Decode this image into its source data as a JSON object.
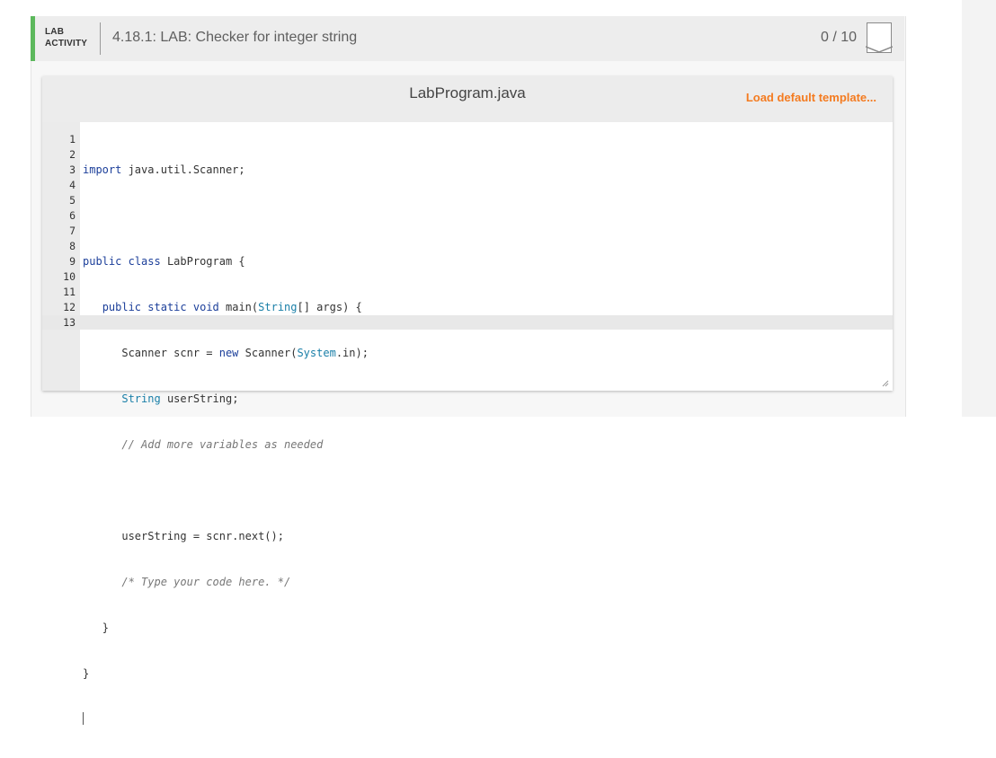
{
  "activity": {
    "type_line1": "LAB",
    "type_line2": "ACTIVITY",
    "title": "4.18.1: LAB: Checker for integer string",
    "score": "0 / 10",
    "accent_color": "#5cb85c"
  },
  "editor": {
    "file_name": "LabProgram.java",
    "load_template_label": "Load default template...",
    "load_template_color": "#f47b20",
    "line_numbers": [
      "1",
      "2",
      "3",
      "4",
      "5",
      "6",
      "7",
      "8",
      "9",
      "10",
      "11",
      "12",
      "13"
    ],
    "code": {
      "l1_kw": "import",
      "l1_rest": " java.util.Scanner;",
      "l3_kw1": "public",
      "l3_kw2": "class",
      "l3_rest": " LabProgram {",
      "l4_kw1": "public",
      "l4_kw2": "static",
      "l4_kw3": "void",
      "l4_mid": " main(",
      "l4_type": "String",
      "l4_rest": "[] args) {",
      "l5_a": "Scanner scnr = ",
      "l5_kw": "new",
      "l5_b": " Scanner(",
      "l5_type": "System",
      "l5_c": ".in);",
      "l6_type": "String",
      "l6_rest": " userString;",
      "l7_comment": "// Add more variables as needed",
      "l9": "userString = scnr.next();",
      "l10_comment": "/* Type your code here. */",
      "l11": "}",
      "l12": "}"
    }
  }
}
